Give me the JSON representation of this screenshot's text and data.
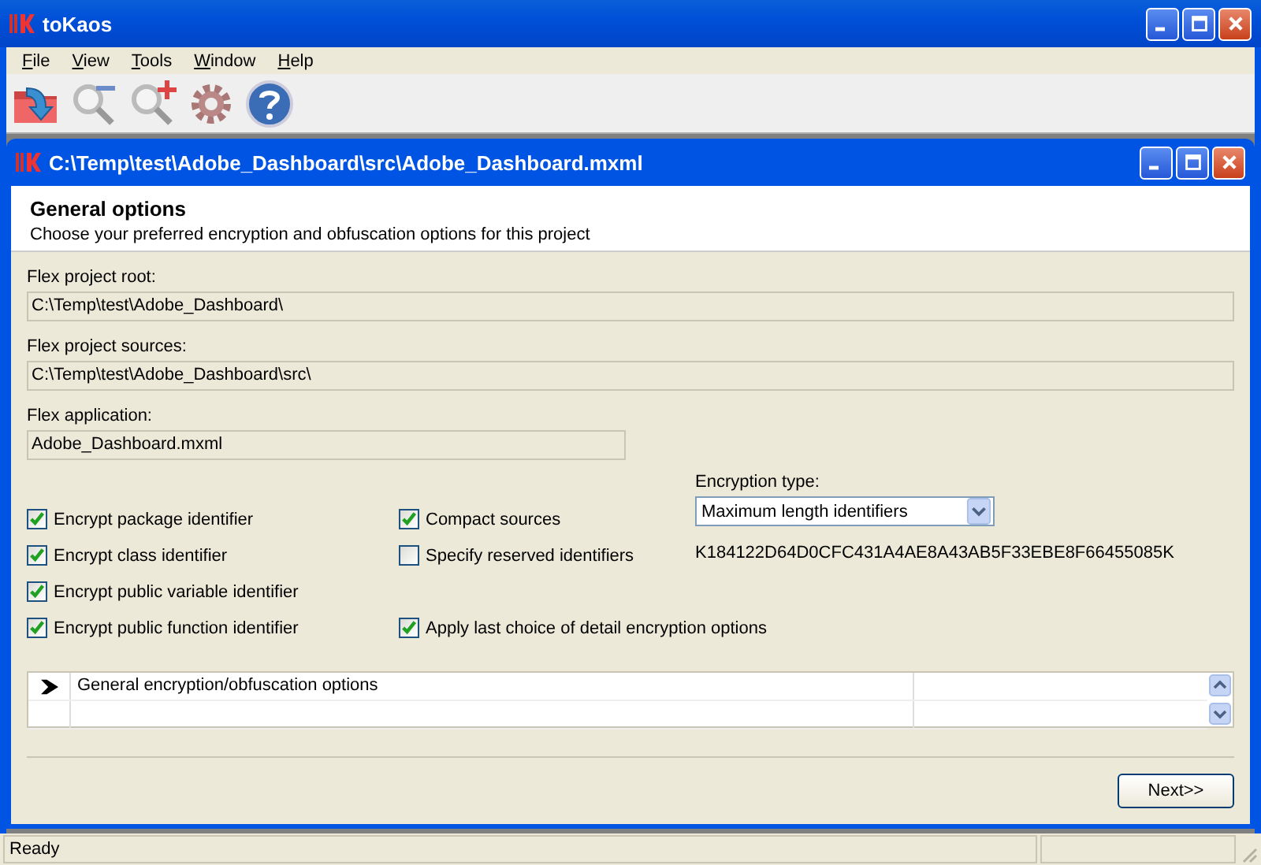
{
  "window": {
    "title": "toKaos"
  },
  "menu": [
    "File",
    "View",
    "Tools",
    "Window",
    "Help"
  ],
  "toolbar": [
    {
      "kind": "open"
    },
    {
      "kind": "zoom-out"
    },
    {
      "kind": "zoom-in"
    },
    {
      "kind": "settings"
    },
    {
      "kind": "help"
    }
  ],
  "document": {
    "title": "C:\\Temp\\test\\Adobe_Dashboard\\src\\Adobe_Dashboard.mxml",
    "header": {
      "title": "General options",
      "subtitle": "Choose your preferred encryption and obfuscation options for this project"
    },
    "fields": [
      {
        "label": "Flex project root:",
        "value": "C:\\Temp\\test\\Adobe_Dashboard\\",
        "kind": "wide"
      },
      {
        "label": "Flex project sources:",
        "value": "C:\\Temp\\test\\Adobe_Dashboard\\src\\",
        "kind": "wide"
      },
      {
        "label": "Flex application:",
        "value": "Adobe_Dashboard.mxml",
        "kind": "narrow"
      }
    ],
    "left_options": [
      {
        "label": "Encrypt package identifier",
        "checked": true
      },
      {
        "label": "Encrypt class identifier",
        "checked": true
      },
      {
        "label": "Encrypt public variable identifier",
        "checked": true
      },
      {
        "label": "Encrypt public function identifier",
        "checked": true
      }
    ],
    "middle_options": [
      {
        "label": "Compact sources",
        "checked": true
      },
      {
        "label": "Specify reserved identifiers",
        "checked": false
      }
    ],
    "apply_option": {
      "label": "Apply last choice of detail encryption options",
      "checked": true
    },
    "encryption_type": {
      "label": "Encryption type:",
      "value": "Maximum length identifiers"
    },
    "key": "K184122D64D0CFC431A4AE8A43AB5F33EBE8F66455085K",
    "grid": {
      "rows": [
        {
          "label": "General encryption/obfuscation options",
          "current": true
        }
      ]
    },
    "next_button": "Next>>"
  },
  "status_bar": {
    "text": "Ready"
  }
}
